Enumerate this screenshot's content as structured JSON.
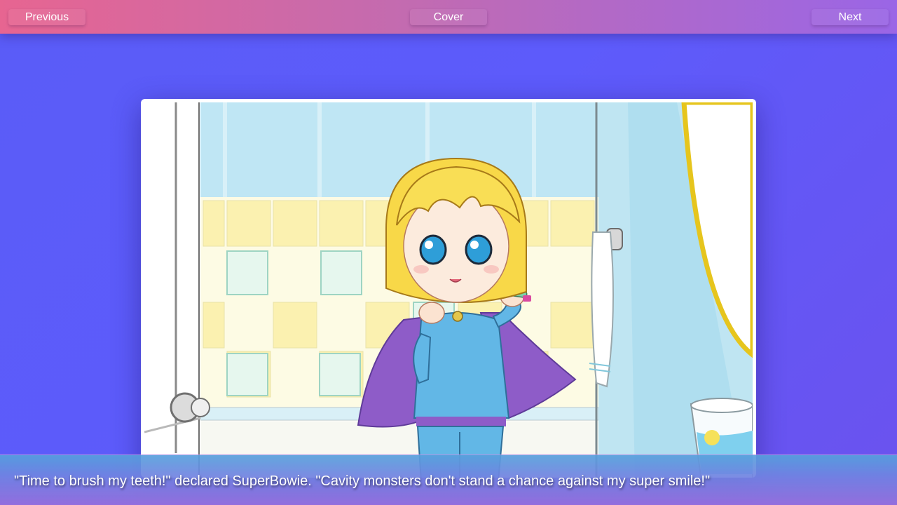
{
  "nav": {
    "previous_label": "Previous",
    "cover_label": "Cover",
    "next_label": "Next"
  },
  "page": {
    "caption": "\"Time to brush my teeth!\" declared SuperBowie. \"Cavity monsters don't stand a chance against my super smile!\"",
    "illustration_icon": "storybook-illustration-girl-brushing-teeth"
  },
  "colors": {
    "background": "#5d5bfb",
    "topbar_start": "#e76591",
    "topbar_end": "#9a66e6",
    "caption_bar": "#7084e1"
  }
}
